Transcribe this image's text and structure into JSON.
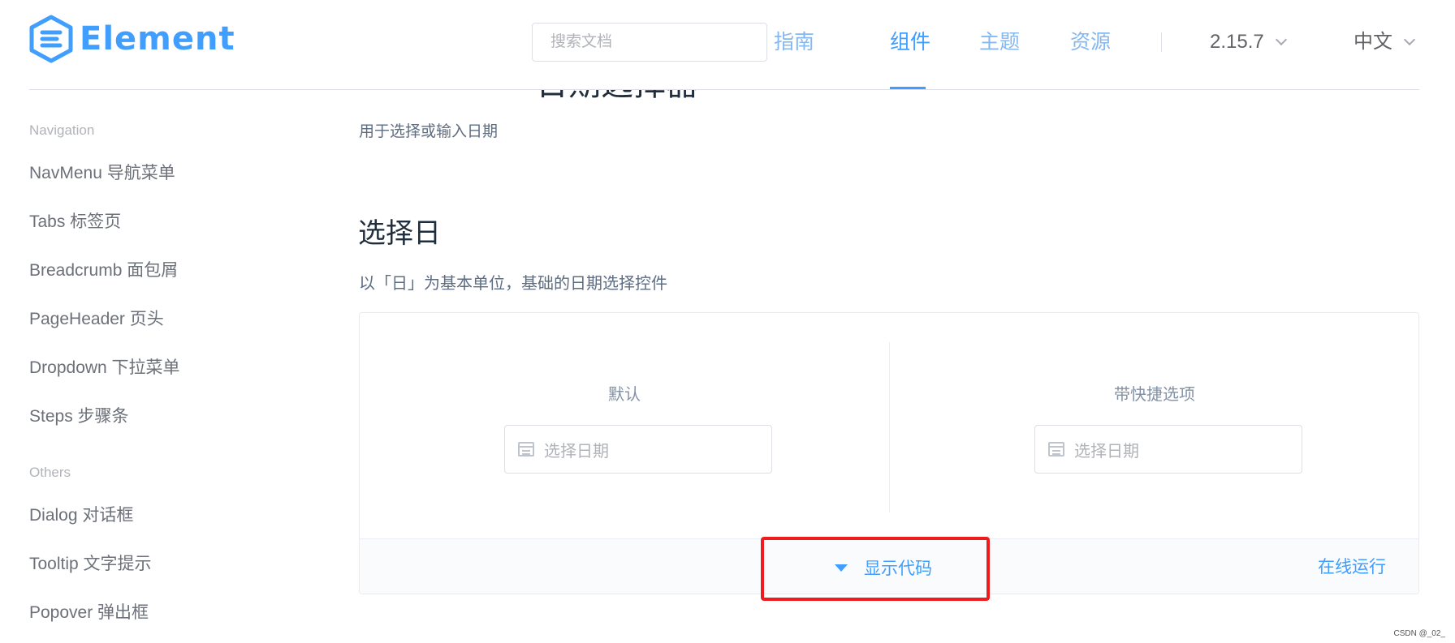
{
  "header": {
    "logo_text": "Element",
    "search_placeholder": "搜索文档",
    "nav": [
      {
        "label": "指南",
        "active": false
      },
      {
        "label": "组件",
        "active": true
      },
      {
        "label": "主题",
        "active": false
      },
      {
        "label": "资源",
        "active": false
      }
    ],
    "version": "2.15.7",
    "language": "中文"
  },
  "sidebar": {
    "groups": [
      {
        "title": "Navigation",
        "items": [
          "NavMenu 导航菜单",
          "Tabs 标签页",
          "Breadcrumb 面包屑",
          "PageHeader 页头",
          "Dropdown 下拉菜单",
          "Steps 步骤条"
        ]
      },
      {
        "title": "Others",
        "items": [
          "Dialog 对话框",
          "Tooltip 文字提示",
          "Popover 弹出框"
        ]
      }
    ]
  },
  "main": {
    "page_title": "日期选择器",
    "page_desc": "用于选择或输入日期",
    "section_title": "选择日",
    "section_desc": "以「日」为基本单位，基础的日期选择控件",
    "demo": {
      "left_label": "默认",
      "right_label": "带快捷选项",
      "date_placeholder": "选择日期",
      "toggle_code": "显示代码",
      "run_online": "在线运行"
    }
  },
  "colors": {
    "primary": "#409eff",
    "highlight": "#ee1c1c"
  },
  "watermark": "CSDN @_02_"
}
